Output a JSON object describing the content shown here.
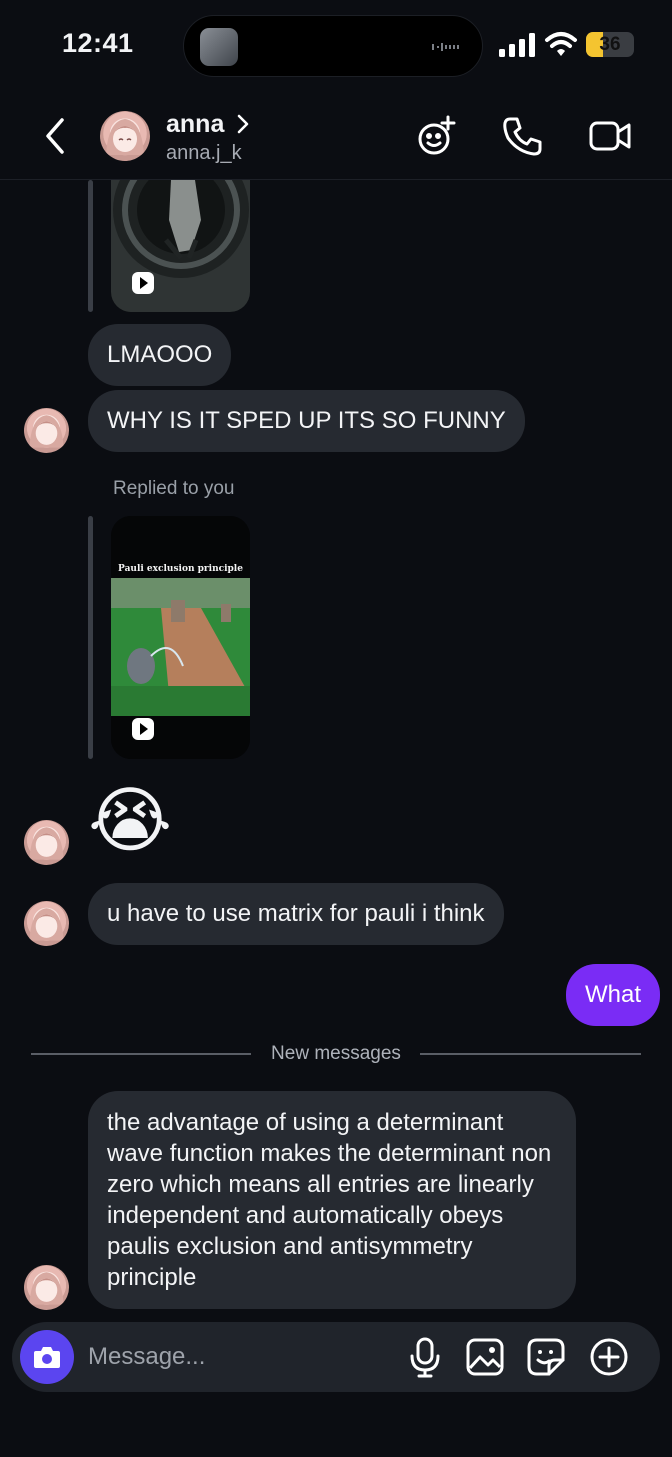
{
  "status_bar": {
    "time": "12:41",
    "battery": "36",
    "battery_level_percent": 36,
    "icons": [
      "signal-icon",
      "wifi-icon",
      "battery-icon"
    ]
  },
  "header": {
    "name": "anna",
    "username": "anna.j_k",
    "actions": [
      "add-effect-icon",
      "phone-call-icon",
      "video-call-icon"
    ]
  },
  "conversation": {
    "messages": [
      {
        "type": "reply_media",
        "icon": "play-icon"
      },
      {
        "type": "text",
        "text": "LMAOOO"
      },
      {
        "type": "text",
        "text": "WHY IS IT SPED UP ITS SO FUNNY"
      },
      {
        "type": "reply_media",
        "reply_label": "Replied to you",
        "media_caption": "Pauli exclusion principle",
        "icon": "play-icon"
      },
      {
        "type": "emoji",
        "text": "😭"
      },
      {
        "type": "text",
        "text": "u have to use matrix for pauli i think"
      },
      {
        "type": "text",
        "sender": "me",
        "text": "What"
      },
      {
        "type": "text",
        "text": "the advantage of using a determinant wave function makes the determinant non zero which means all entries are linearly independent and automatically obeys paulis exclusion and antisymmetry principle"
      }
    ],
    "separator": "New messages"
  },
  "composer": {
    "placeholder": "Message...",
    "icons": [
      "camera-icon",
      "microphone-icon",
      "gallery-icon",
      "sticker-icon",
      "add-icon"
    ]
  },
  "colors": {
    "background": "#0b0d12",
    "bubble_incoming": "#262a31",
    "bubble_outgoing": "#7a2cf5",
    "camera_button": "#5b45f0",
    "battery": "#f4c430"
  }
}
